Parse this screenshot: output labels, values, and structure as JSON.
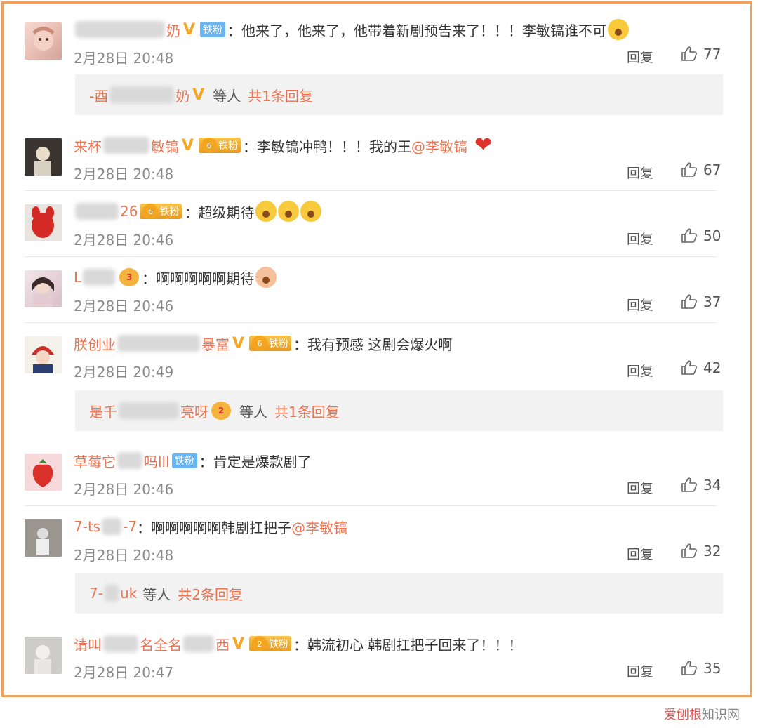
{
  "comments": [
    {
      "name_pre": "",
      "name_post": "奶",
      "badge_v": "V",
      "fan": "铁粉",
      "text": "：他来了，他来了，他带着新剧预告来了！！！李敏镐谁不可",
      "time": "2月28日 20:48",
      "reply": "回复",
      "likes": "77"
    },
    {
      "name_pre": "来杯",
      "name_post": "敏镐",
      "badge_v": "V",
      "fan": "铁粉",
      "text": "：李敏镐冲鸭！！！我的王",
      "mention": "@李敏镐",
      "time": "2月28日 20:48",
      "reply": "回复",
      "likes": "67"
    },
    {
      "name_pre": "",
      "name_post": "26",
      "fan": "铁粉",
      "text": "：超级期待",
      "time": "2月28日 20:46",
      "reply": "回复",
      "likes": "50"
    },
    {
      "name_pre": "L",
      "name_post": "",
      "text": "：啊啊啊啊啊期待",
      "time": "2月28日 20:46",
      "reply": "回复",
      "likes": "37"
    },
    {
      "name_pre": "朕创业",
      "name_post": "暴富",
      "badge_v": "V",
      "fan": "铁粉",
      "text": "：我有预感 这剧会爆火啊",
      "time": "2月28日 20:49",
      "reply": "回复",
      "likes": "42"
    },
    {
      "name_pre": "草莓它",
      "name_post": "吗lll",
      "fan": "铁粉",
      "text": "：肯定是爆款剧了",
      "time": "2月28日 20:46",
      "reply": "回复",
      "likes": "34"
    },
    {
      "name_pre": "7-ts",
      "name_post": "-7",
      "text": "：啊啊啊啊啊韩剧扛把子",
      "mention": "@李敏镐",
      "time": "2月28日 20:48",
      "reply": "回复",
      "likes": "32"
    },
    {
      "name_pre": "请叫",
      "name_post": "西",
      "name_mid": "名全名",
      "badge_v": "V",
      "fan": "铁粉",
      "text": "：韩流初心 韩剧扛把子回来了！！！",
      "time": "2月28日 20:47",
      "reply": "回复",
      "likes": "35"
    }
  ],
  "subreplies": [
    {
      "name_pre": "-酉",
      "name_post": "奶",
      "badge_v": "V",
      "suffix": "等人",
      "count": "共1条回复"
    },
    {
      "name_pre": "是千",
      "name_post": "亮呀",
      "suffix": "等人",
      "count": "共1条回复"
    },
    {
      "name_pre": "7-",
      "name_post": "uk",
      "suffix": "等人",
      "count": "共2条回复"
    }
  ],
  "watermark": {
    "part1": "爱刨根",
    "part2": "知识网"
  },
  "colors": {
    "accent": "#eb7350",
    "border": "#f0a15e",
    "v_badge": "#f5a623",
    "fan_blue": "#6ab4ef"
  }
}
